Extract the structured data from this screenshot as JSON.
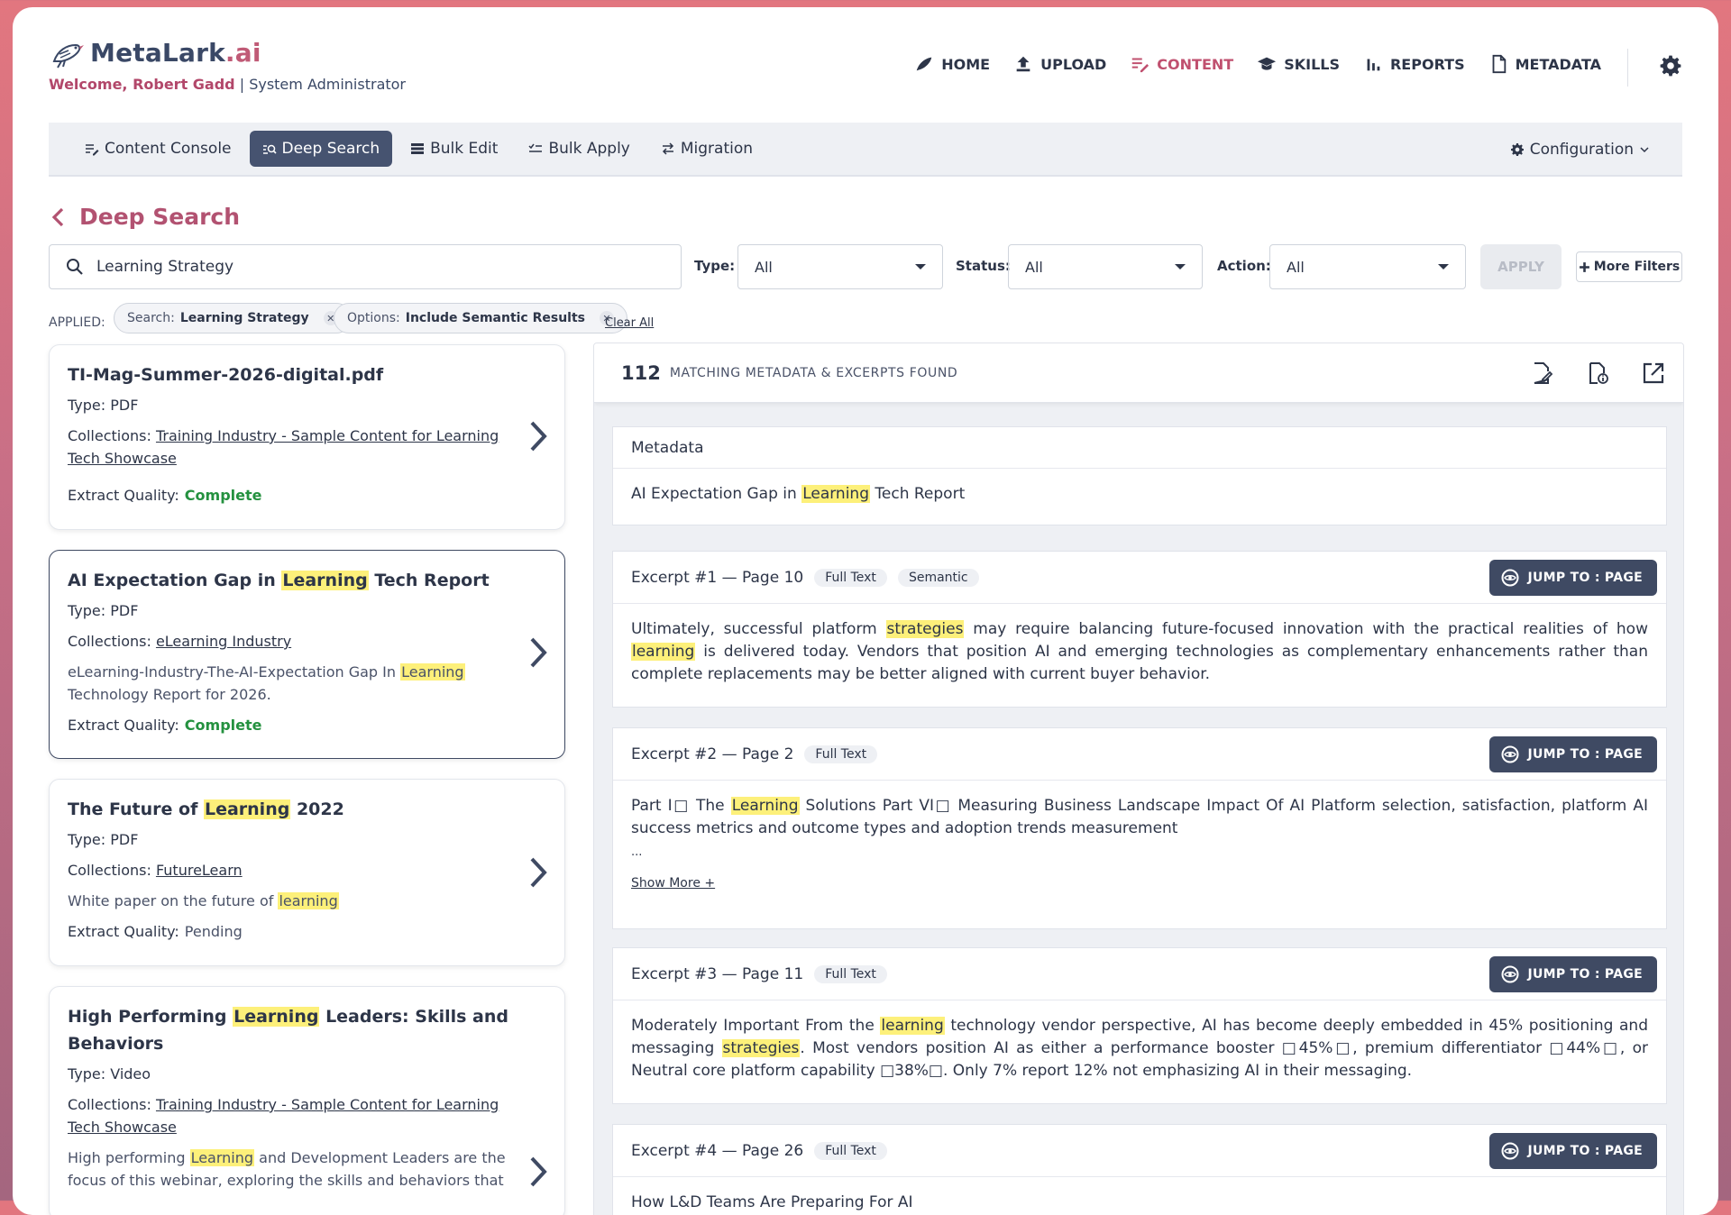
{
  "brand": {
    "name_main": "MetaLark",
    "name_ai": ".ai"
  },
  "welcome": {
    "prefix": "Welcome, ",
    "name": "Robert Gadd",
    "role": " | System Administrator"
  },
  "topnav": [
    {
      "label": "HOME",
      "icon": "bird-icon"
    },
    {
      "label": "UPLOAD",
      "icon": "upload-icon"
    },
    {
      "label": "CONTENT",
      "icon": "content-list-icon",
      "active": true
    },
    {
      "label": "SKILLS",
      "icon": "graduation-cap-icon"
    },
    {
      "label": "REPORTS",
      "icon": "bar-chart-icon"
    },
    {
      "label": "METADATA",
      "icon": "document-icon"
    }
  ],
  "subnav": {
    "items": [
      "Content Console",
      "Deep Search",
      "Bulk Edit",
      "Bulk Apply",
      "Migration"
    ],
    "active": "Deep Search",
    "config_label": "Configuration"
  },
  "page": {
    "title": "Deep Search"
  },
  "search": {
    "value": "Learning Strategy",
    "type_label": "Type:",
    "type_value": "All",
    "status_label": "Status:",
    "status_value": "All",
    "action_label": "Action:",
    "action_value": "All",
    "apply_label": "APPLY",
    "more_filters_label": "More Filters"
  },
  "applied": {
    "label": "APPLIED:",
    "chips": [
      {
        "key": "Search:",
        "value": "Learning Strategy"
      },
      {
        "key": "Options:",
        "value": "Include Semantic Results"
      }
    ],
    "clear_label": "Clear All"
  },
  "results": [
    {
      "title_pre": "TI-Mag-Summer-2026-digital.pdf",
      "title_hl": "",
      "title_post": "",
      "type": "Type: PDF",
      "collections_label": "Collections: ",
      "collection": "Training Industry - Sample Content for Learning Tech Showcase",
      "desc_pre": "",
      "desc_hl": "",
      "desc_post": "",
      "quality_label": "Extract Quality:",
      "quality": "Complete"
    },
    {
      "title_pre": "AI Expectation Gap in ",
      "title_hl": "Learning",
      "title_post": " Tech Report",
      "type": "Type: PDF",
      "collections_label": "Collections: ",
      "collection": "eLearning Industry",
      "desc_pre": "eLearning-Industry-The-AI-Expectation Gap In ",
      "desc_hl": "Learning",
      "desc_post": " Technology Report for 2026.",
      "quality_label": "Extract Quality:",
      "quality": "Complete"
    },
    {
      "title_pre": "The Future of ",
      "title_hl": "Learning",
      "title_post": " 2022",
      "type": "Type: PDF",
      "collections_label": "Collections: ",
      "collection": "FutureLearn",
      "desc_pre": "White paper on the future of ",
      "desc_hl": "learning",
      "desc_post": "",
      "quality_label": "Extract Quality:",
      "quality": "Pending"
    },
    {
      "title_pre": "High Performing ",
      "title_hl": "Learning",
      "title_post": " Leaders: Skills and Behaviors",
      "type": "Type: Video",
      "collections_label": "Collections: ",
      "collection": "Training Industry - Sample Content for Learning Tech Showcase",
      "desc_pre": "High performing ",
      "desc_hl": "Learning",
      "desc_post": " and Development Leaders are the focus of this webinar, exploring the skills and behaviors that",
      "quality_label": "",
      "quality": ""
    }
  ],
  "panel": {
    "count": "112",
    "count_text": "MATCHING METADATA & EXCERPTS FOUND",
    "metadata_header": "Metadata",
    "metadata_pre": "AI Expectation Gap in ",
    "metadata_hl": "Learning",
    "metadata_post": " Tech Report",
    "jump_label": "JUMP TO : PAGE",
    "show_more": "Show More +",
    "excerpts": [
      {
        "header": "Excerpt #1 — Page 10",
        "tags": [
          "Full Text",
          "Semantic"
        ],
        "p1": "Ultimately, successful platform ",
        "h1": "strategies",
        "p2": " may require balancing future-focused innovation with the practical realities of how ",
        "h2": "learning",
        "p3": " is delivered today. Vendors that position AI and emerging technologies as complementary enhancements rather than complete replacements may be better aligned with current buyer behavior.",
        "tail": ""
      },
      {
        "header": "Excerpt #2 — Page 2",
        "tags": [
          "Full Text"
        ],
        "p1": "Part I□ The ",
        "h1": "Learning",
        "p2": " Solutions Part VI□ Measuring Business Landscape Impact Of AI Platform selection, satisfaction, platform AI success metrics and outcome types and adoption trends measurement",
        "h2": "",
        "p3": "",
        "tail": "..."
      },
      {
        "header": "Excerpt #3 — Page 11",
        "tags": [
          "Full Text"
        ],
        "p1": "Moderately Important From the ",
        "h1": "learning",
        "p2": " technology vendor perspective, AI has become deeply embedded in 45% positioning and messaging ",
        "h2": "strategies",
        "p3": ". Most vendors position AI as either a performance booster □45%□, premium differentiator □44%□, or Neutral core platform capability □38%□. Only 7% report 12% not emphasizing AI in their messaging.",
        "tail": ""
      },
      {
        "header": "Excerpt #4 — Page 26",
        "tags": [
          "Full Text"
        ],
        "p1": "How L&D Teams Are Preparing For AI",
        "h1": "",
        "p2": "",
        "h2": "",
        "p3": "",
        "tail": ""
      }
    ]
  },
  "colors": {
    "brand_pink": "#c0506f",
    "navy": "#3f4a63",
    "complete_green": "#24913f",
    "highlight": "#fdf07a"
  }
}
